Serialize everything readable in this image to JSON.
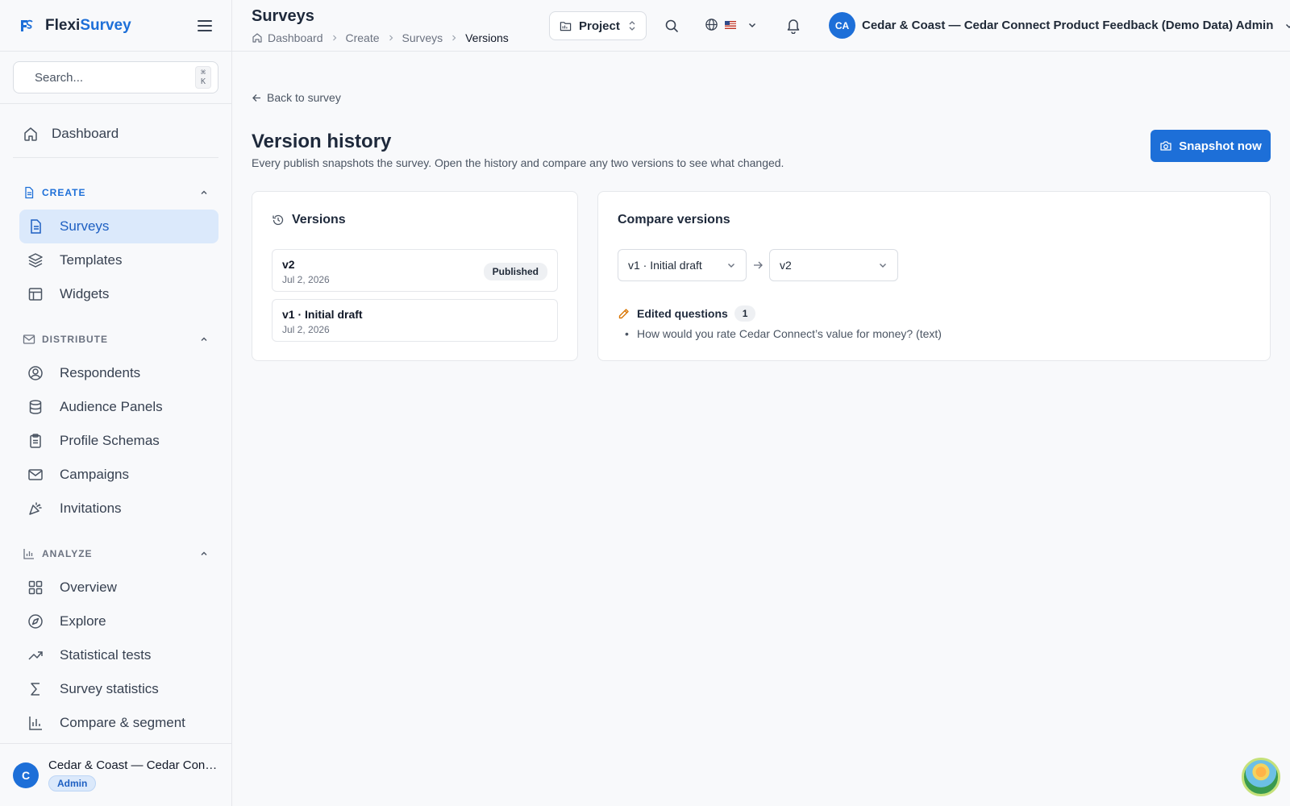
{
  "brand": {
    "name_prefix": "Flexi",
    "name_suffix": "Survey"
  },
  "search": {
    "placeholder": "Search...",
    "shortcut": "⌘ K"
  },
  "sidebar": {
    "dashboard": "Dashboard",
    "sections": {
      "create": {
        "label": "CREATE",
        "items": [
          "Surveys",
          "Templates",
          "Widgets"
        ]
      },
      "distribute": {
        "label": "DISTRIBUTE",
        "items": [
          "Respondents",
          "Audience Panels",
          "Profile Schemas",
          "Campaigns",
          "Invitations"
        ]
      },
      "analyze": {
        "label": "ANALYZE",
        "items": [
          "Overview",
          "Explore",
          "Statistical tests",
          "Survey statistics",
          "Compare & segment"
        ]
      }
    },
    "active_item": "Surveys",
    "footer": {
      "avatar": "C",
      "name": "Cedar & Coast — Cedar Connect Product Feedback (Demo Data) Admin",
      "role": "Admin"
    }
  },
  "header": {
    "title": "Surveys",
    "breadcrumb": [
      "Dashboard",
      "Create",
      "Surveys",
      "Versions"
    ],
    "project_label": "Project",
    "user": {
      "initials": "CA",
      "name": "Cedar & Coast — Cedar Connect Product Feedback (Demo Data) Admin"
    }
  },
  "main": {
    "back_label": "Back to survey",
    "title": "Version history",
    "subtitle": "Every publish snapshots the survey. Open the history and compare any two versions to see what changed.",
    "snapshot_label": "Snapshot now",
    "versions_card": {
      "title": "Versions",
      "items": [
        {
          "name": "v2",
          "date": "Jul 2, 2026",
          "badge": "Published"
        },
        {
          "name": "v1 · Initial draft",
          "date": "Jul 2, 2026",
          "badge": ""
        }
      ]
    },
    "compare_card": {
      "title": "Compare versions",
      "from": "v1 · Initial draft",
      "to": "v2",
      "edited_label": "Edited questions",
      "edited_count": "1",
      "edited_items": [
        "How would you rate Cedar Connect’s value for money? (text)"
      ]
    }
  },
  "colors": {
    "accent": "#1d6fd8",
    "active_bg": "#dbe9fb",
    "edit_icon": "#d97706"
  },
  "icons": {
    "help": "help-orb-icon"
  }
}
